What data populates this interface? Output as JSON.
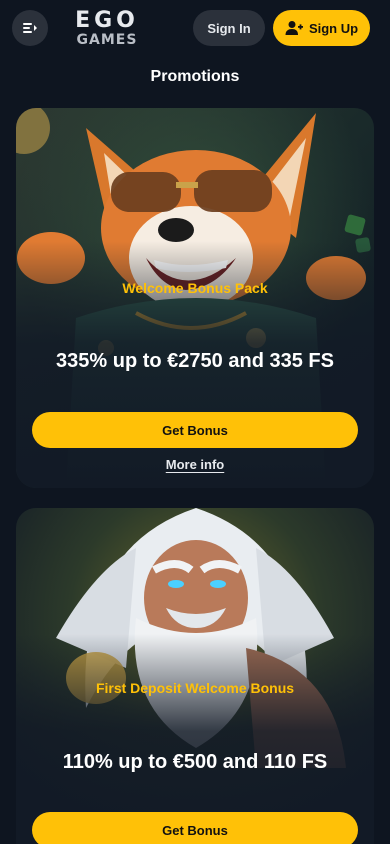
{
  "header": {
    "logo_top": "EGO",
    "logo_bottom": "GAMES",
    "signin_label": "Sign In",
    "signup_label": "Sign Up"
  },
  "page": {
    "title": "Promotions"
  },
  "promotions": [
    {
      "subtitle": "Welcome Bonus Pack",
      "title": "335% up to €2750 and 335 FS",
      "button_label": "Get Bonus",
      "more_info_label": "More info"
    },
    {
      "subtitle": "First Deposit Welcome Bonus",
      "title": "110% up to €500 and 110 FS",
      "button_label": "Get Bonus"
    }
  ],
  "colors": {
    "background": "#0e1520",
    "accent": "#ffc107",
    "button_dark": "#2b313b"
  },
  "icons": [
    "menu-icon",
    "user-plus-icon"
  ]
}
